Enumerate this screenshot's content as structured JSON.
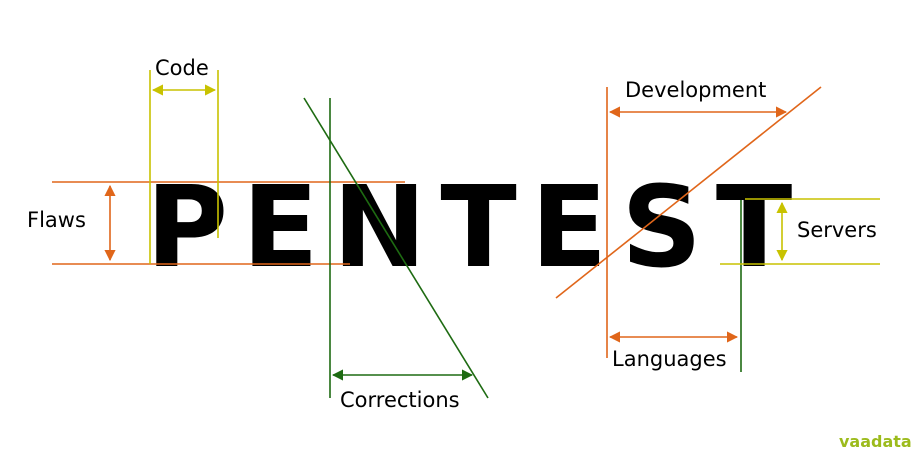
{
  "title_word": "PENTEST",
  "labels": {
    "code": "Code",
    "flaws": "Flaws",
    "corrections": "Corrections",
    "development": "Development",
    "servers": "Servers",
    "languages": "Languages"
  },
  "logo": "vaadata",
  "colors": {
    "orange": "#E0661A",
    "yellow": "#C8C200",
    "green": "#1E6B12",
    "text": "#000000",
    "logo_green": "#9CBB1C",
    "logo_dark": "#2B2B2B"
  }
}
